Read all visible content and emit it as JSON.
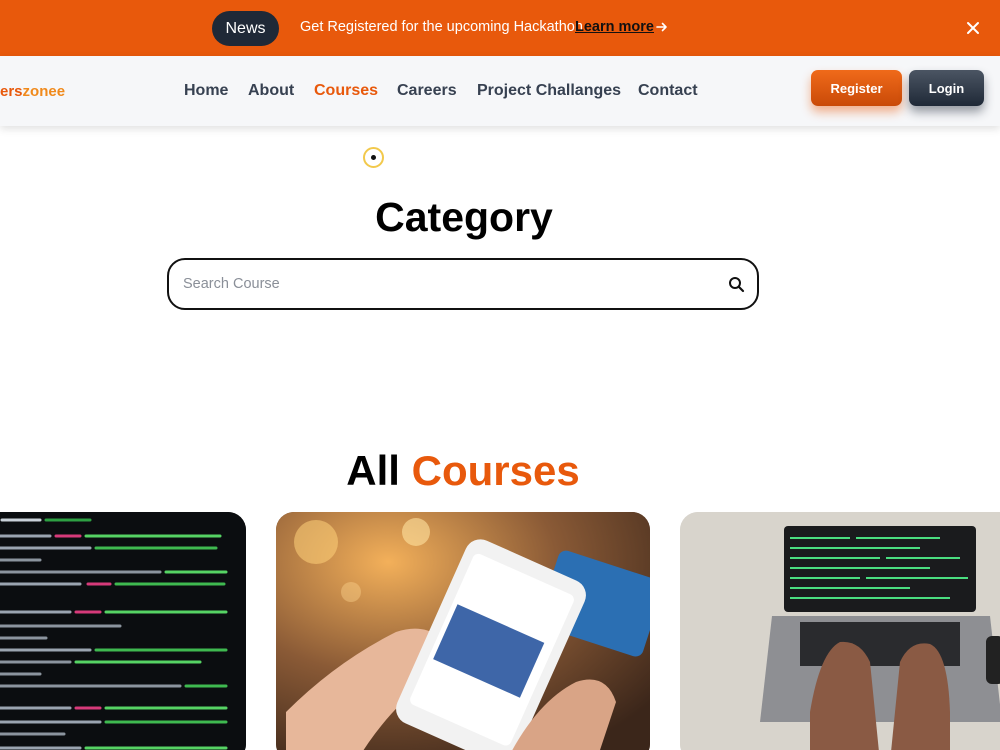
{
  "announcement": {
    "badge": "News",
    "text": "Get Registered for the upcoming Hackathon",
    "link_label": "Learn more",
    "arrow_icon": "arrow-right-icon",
    "close_icon": "close-icon",
    "background": "#e8590c"
  },
  "navbar": {
    "brand_part1": "ers",
    "brand_part2": "zonee",
    "links": [
      "Home",
      "About",
      "Courses",
      "Careers",
      "Project Challanges",
      "Contact"
    ],
    "active_link": "Courses",
    "register_label": "Register",
    "login_label": "Login"
  },
  "category": {
    "title": "Category",
    "search_placeholder": "Search Course",
    "search_value": "",
    "search_icon": "search-icon"
  },
  "courses": {
    "heading_part1": "All",
    "heading_part2": "Courses",
    "cards": [
      {
        "image": "code-on-screen-image"
      },
      {
        "image": "phone-ecommerce-image"
      },
      {
        "image": "laptop-typing-image"
      }
    ]
  },
  "colors": {
    "accent": "#e8590c",
    "dark": "#1f2937",
    "nav_text": "#374151"
  }
}
